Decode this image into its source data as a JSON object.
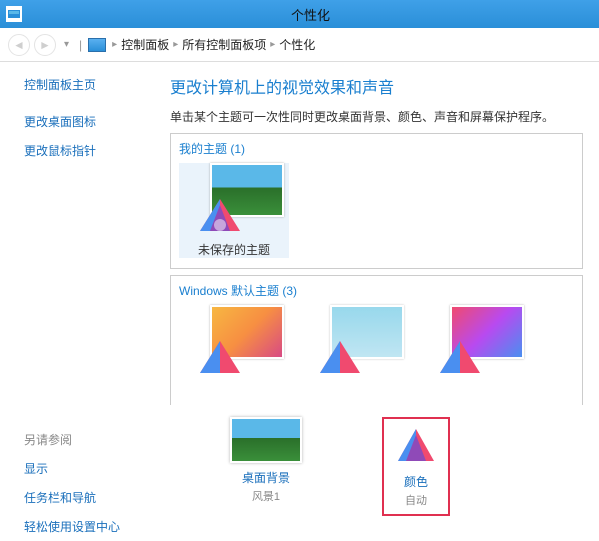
{
  "window": {
    "title": "个性化"
  },
  "breadcrumb": {
    "items": [
      "控制面板",
      "所有控制面板项",
      "个性化"
    ]
  },
  "sidebar": {
    "home": "控制面板主页",
    "links": [
      "更改桌面图标",
      "更改鼠标指针"
    ],
    "see_also_label": "另请参阅",
    "see_also": [
      "显示",
      "任务栏和导航",
      "轻松使用设置中心"
    ]
  },
  "main": {
    "heading": "更改计算机上的视觉效果和声音",
    "subtext": "单击某个主题可一次性同时更改桌面背景、颜色、声音和屏幕保护程序。"
  },
  "groups": {
    "my_themes": {
      "title": "我的主题 (1)",
      "items": [
        {
          "label": "未保存的主题"
        }
      ]
    },
    "win_themes": {
      "title": "Windows 默认主题 (3)"
    }
  },
  "bottom": {
    "bg": {
      "label": "桌面背景",
      "value": "风景1"
    },
    "color": {
      "label": "颜色",
      "value": "自动"
    }
  }
}
